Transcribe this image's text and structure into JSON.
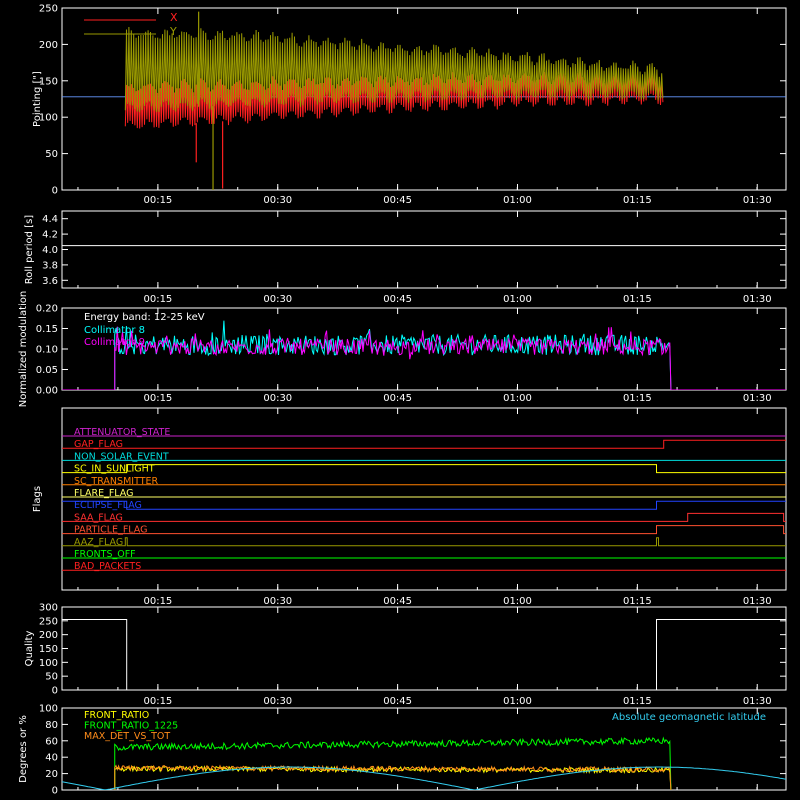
{
  "time_ticks": [
    "00:15",
    "00:30",
    "00:45",
    "01:00",
    "01:15",
    "01:30"
  ],
  "time_tick_hours": [
    0.25,
    0.5,
    0.75,
    1.0,
    1.25,
    1.5
  ],
  "time_range_hours": [
    0.05,
    1.56
  ],
  "chart_data": [
    {
      "type": "line",
      "ylabel": "Pointing [\"]",
      "ylim": [
        0,
        250
      ],
      "yticks": [
        "0",
        "50",
        "100",
        "150",
        "200",
        "250"
      ],
      "ytick_values": [
        0,
        50,
        100,
        150,
        200,
        250
      ],
      "legend": "top-left",
      "series": [
        {
          "name": "X",
          "color": "#ff2020",
          "start_h": 0.182,
          "end_h": 1.305,
          "env_low": [
            85,
            98,
            110,
            118,
            122
          ],
          "env_high": [
            145,
            150,
            155,
            158,
            160
          ],
          "spikes": [
            [
              0.33,
              38
            ],
            [
              0.385,
              2
            ]
          ]
        },
        {
          "name": "Y",
          "color": "#999900",
          "start_h": 0.182,
          "end_h": 1.305,
          "env_low": [
            110,
            118,
            125,
            130,
            128
          ],
          "env_high": [
            220,
            215,
            200,
            185,
            168
          ],
          "spikes": [
            [
              0.365,
              0
            ],
            [
              0.335,
              245
            ]
          ]
        }
      ],
      "reference_line": {
        "value": 128,
        "color": "#6699ff"
      }
    },
    {
      "type": "line",
      "ylabel": "Roll period [s]",
      "ylim": [
        3.5,
        4.5
      ],
      "yticks": [
        "3.6",
        "3.8",
        "4.0",
        "4.2",
        "4.4"
      ],
      "ytick_values": [
        3.6,
        3.8,
        4.0,
        4.2,
        4.4
      ],
      "series": [
        {
          "color": "#ffffff",
          "constant": 4.05
        }
      ]
    },
    {
      "type": "line",
      "ylabel": "Normalized modulation",
      "ylim": [
        0,
        0.2
      ],
      "yticks": [
        "0.00",
        "0.05",
        "0.10",
        "0.15",
        "0.20"
      ],
      "ytick_values": [
        0,
        0.05,
        0.1,
        0.15,
        0.2
      ],
      "annotation": "Energy band: 12-25 keV",
      "legend": "top-left",
      "series": [
        {
          "name": "Collimator 8",
          "color": "#00ffff",
          "start_h": 0.16,
          "end_h": 1.32,
          "mean": 0.11,
          "spread": 0.025
        },
        {
          "name": "Collimator 9",
          "color": "#ff00ff",
          "start_h": 0.16,
          "end_h": 1.32,
          "mean": 0.105,
          "spread": 0.02
        }
      ]
    },
    {
      "type": "line",
      "ylabel": "Flags",
      "flags": [
        {
          "name": "ATTENUATOR_STATE",
          "color": "#cc22cc",
          "transitions": []
        },
        {
          "name": "GAP_FLAG",
          "color": "#ff2020",
          "transitions": [
            [
              1.305,
              1
            ]
          ]
        },
        {
          "name": "NON_SOLAR_EVENT",
          "color": "#00dddd",
          "transitions": []
        },
        {
          "name": "SC_IN_SUNLIGHT",
          "color": "#ffff00",
          "transitions": [
            [
              0.185,
              1
            ],
            [
              1.29,
              0
            ]
          ]
        },
        {
          "name": "SC_TRANSMITTER",
          "color": "#ff7f00",
          "transitions": []
        },
        {
          "name": "FLARE_FLAG",
          "color": "#ffff66",
          "transitions": []
        },
        {
          "name": "ECLIPSE_FLAG",
          "color": "#2244ff",
          "transitions": [
            [
              0.185,
              0
            ],
            [
              1.29,
              1
            ]
          ]
        },
        {
          "name": "SAA_FLAG",
          "color": "#ff3030",
          "transitions": [
            [
              1.355,
              1
            ],
            [
              1.555,
              0
            ]
          ]
        },
        {
          "name": "PARTICLE_FLAG",
          "color": "#ff5030",
          "transitions": [
            [
              1.29,
              1
            ],
            [
              1.555,
              0
            ]
          ]
        },
        {
          "name": "AAZ_FLAG",
          "color": "#999900",
          "transitions": [
            [
              0.182,
              1
            ],
            [
              0.186,
              0
            ],
            [
              1.29,
              1
            ],
            [
              1.294,
              0
            ]
          ]
        },
        {
          "name": "FRONTS_OFF",
          "color": "#00ff00",
          "transitions": []
        },
        {
          "name": "BAD_PACKETS",
          "color": "#ff2020",
          "transitions": []
        }
      ]
    },
    {
      "type": "line",
      "ylabel": "Quality",
      "ylim": [
        0,
        300
      ],
      "yticks": [
        "0",
        "50",
        "100",
        "150",
        "200",
        "250",
        "300"
      ],
      "ytick_values": [
        0,
        50,
        100,
        150,
        200,
        250,
        300
      ],
      "series": [
        {
          "color": "#ffffff",
          "steps": [
            [
              0.05,
              255
            ],
            [
              0.185,
              0
            ],
            [
              1.29,
              255
            ],
            [
              1.56,
              255
            ]
          ]
        }
      ]
    },
    {
      "type": "line",
      "ylabel": "Degrees or %",
      "ylim": [
        0,
        100
      ],
      "yticks": [
        "0",
        "20",
        "40",
        "60",
        "80",
        "100"
      ],
      "ytick_values": [
        0,
        20,
        40,
        60,
        80,
        100
      ],
      "legend": "top-left",
      "series": [
        {
          "name": "FRONT_RATIO",
          "color": "#ffff00",
          "start_h": 0.16,
          "end_h": 1.32,
          "mean_start": 26,
          "mean_end": 24,
          "spread": 3
        },
        {
          "name": "FRONT_RATIO_1225",
          "color": "#00ff00",
          "start_h": 0.16,
          "end_h": 1.32,
          "mean_start": 52,
          "mean_end": 60,
          "spread": 4
        },
        {
          "name": "MAX_DET_VS_TOT",
          "color": "#ff8c1a",
          "start_h": 0.16,
          "end_h": 1.32,
          "mean_start": 27,
          "mean_end": 25,
          "spread": 3
        },
        {
          "name": "Absolute geomagnetic latitude",
          "color": "#33ccee",
          "latitude": true
        }
      ]
    }
  ]
}
